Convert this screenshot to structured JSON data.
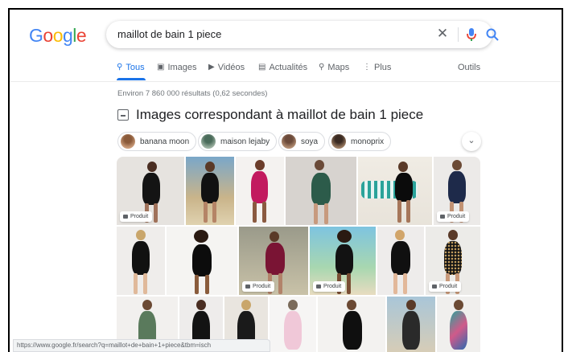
{
  "logo": {
    "letters": [
      "G",
      "o",
      "o",
      "g",
      "l",
      "e"
    ],
    "colors": [
      "#4285F4",
      "#EA4335",
      "#FBBC05",
      "#4285F4",
      "#34A853",
      "#EA4335"
    ]
  },
  "search": {
    "query": "maillot de bain 1 piece",
    "clear_icon": "close-icon",
    "mic_icon": "mic-icon",
    "search_icon": "search-icon"
  },
  "tabs": [
    {
      "label": "Tous",
      "icon": "search-icon",
      "active": true
    },
    {
      "label": "Images",
      "icon": "image-icon"
    },
    {
      "label": "Vidéos",
      "icon": "video-icon"
    },
    {
      "label": "Actualités",
      "icon": "news-icon"
    },
    {
      "label": "Maps",
      "icon": "pin-icon"
    },
    {
      "label": "Plus",
      "icon": "more-icon"
    }
  ],
  "tools_label": "Outils",
  "result_stats": "Environ 7 860 000 résultats (0,62 secondes)",
  "images_heading": "Images correspondant à maillot de bain 1 piece",
  "chips": [
    {
      "label": "banana moon"
    },
    {
      "label": "maison lejaby"
    },
    {
      "label": "soya"
    },
    {
      "label": "monoprix"
    }
  ],
  "product_badge": "Produit",
  "accent_color": "#1a73e8",
  "status_url": "https://www.google.fr/search?q=maillot+de+bain+1+piece&tbm=isch"
}
